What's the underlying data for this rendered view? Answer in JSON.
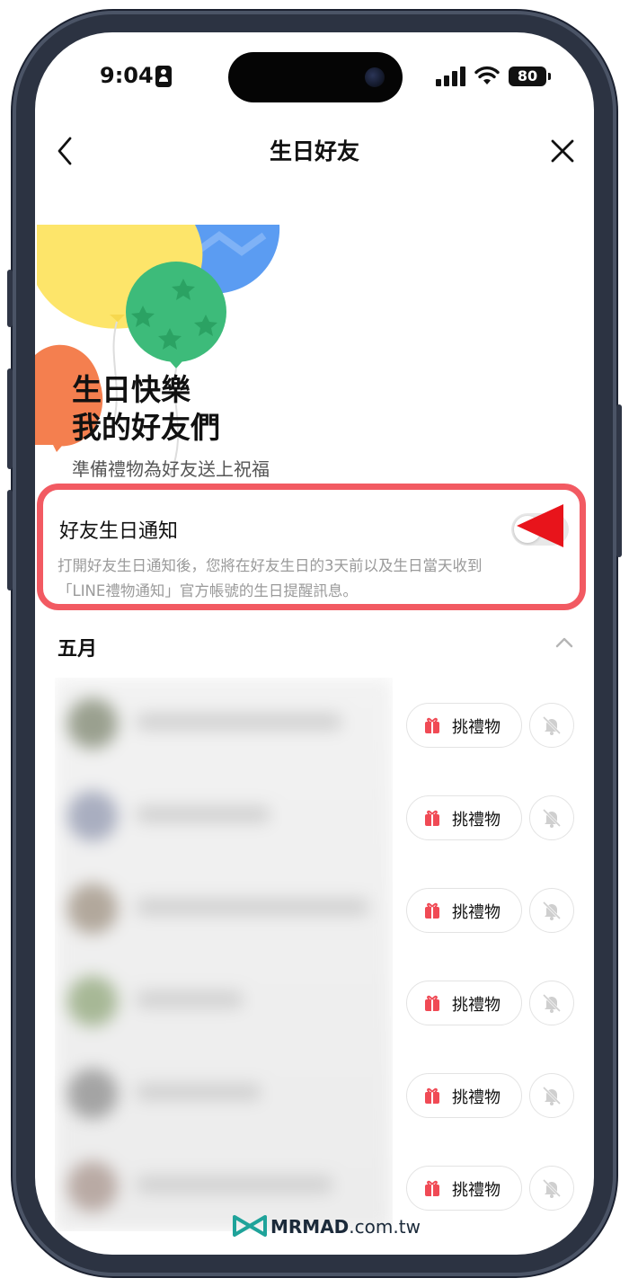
{
  "status_bar": {
    "time": "9:04",
    "battery": "80"
  },
  "nav": {
    "title": "生日好友"
  },
  "hero": {
    "line1": "生日快樂",
    "line2": "我的好友們",
    "subtitle": "準備禮物為好友送上祝福"
  },
  "notification": {
    "title": "好友生日通知",
    "toggle_on": false,
    "desc_line1": "打開好友生日通知後，您將在好友生日的3天前以及生日當天收到",
    "desc_line2": "「LINE禮物通知」官方帳號的生日提醒訊息。"
  },
  "month_section": {
    "label": "五月"
  },
  "friends": [
    {
      "gift_label": "挑禮物"
    },
    {
      "gift_label": "挑禮物"
    },
    {
      "gift_label": "挑禮物"
    },
    {
      "gift_label": "挑禮物"
    },
    {
      "gift_label": "挑禮物"
    },
    {
      "gift_label": "挑禮物"
    }
  ],
  "watermark": {
    "brand": "MRMAD",
    "domain": ".com.tw"
  },
  "colors": {
    "highlight": "#f25a62",
    "arrow": "#e8141b",
    "gift": "#f04a55"
  },
  "icons": [
    "back-chevron-icon",
    "close-icon",
    "gift-icon",
    "bell-off-icon",
    "chevron-up-icon"
  ]
}
